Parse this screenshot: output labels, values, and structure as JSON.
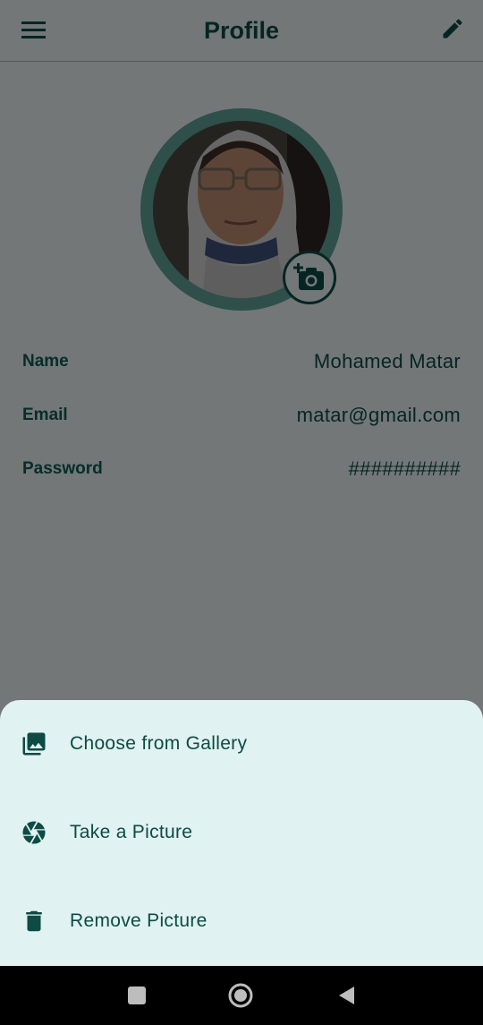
{
  "appbar": {
    "title": "Profile",
    "menu_icon": "menu-icon",
    "edit_icon": "edit-icon"
  },
  "avatar": {
    "ring_color": "#5f9e95",
    "camera_icon": "add-photo-icon"
  },
  "profile": {
    "rows": [
      {
        "label": "Name",
        "value": "Mohamed Matar"
      },
      {
        "label": "Email",
        "value": "matar@gmail.com"
      },
      {
        "label": "Password",
        "value": "##########"
      }
    ]
  },
  "sheet": {
    "items": [
      {
        "label": "Choose from Gallery",
        "icon": "gallery-icon"
      },
      {
        "label": "Take a Picture",
        "icon": "camera-shutter-icon"
      },
      {
        "label": "Remove Picture",
        "icon": "trash-icon"
      }
    ]
  },
  "navbar": {
    "icons": [
      "recents-square-icon",
      "home-circle-icon",
      "back-triangle-icon"
    ]
  },
  "colors": {
    "primary": "#0d4b44",
    "sheet_background": "#e0f2f1",
    "scrim": "rgba(0,0,0,0.5)"
  }
}
